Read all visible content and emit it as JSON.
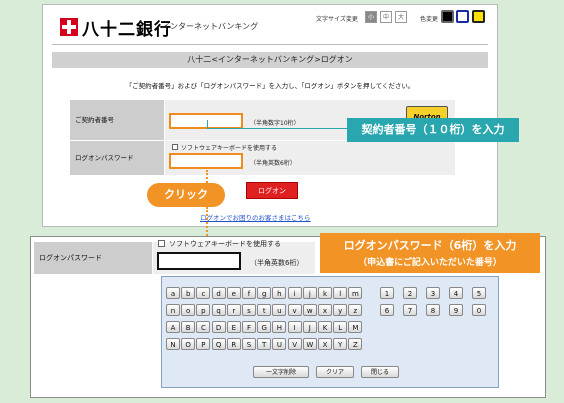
{
  "header": {
    "bank_name": "八十二銀行",
    "subtitle": "インターネットバンキング",
    "font_size_label": "文字サイズ変更",
    "font_sizes": [
      "小",
      "中",
      "大"
    ],
    "color_label": "色変更"
  },
  "page": {
    "title_bar": "八十二<インターネットバンキング>ログオン",
    "instruction": "「ご契約者番号」および「ログオンパスワード」を入力し、「ログオン」ボタンを押してください。",
    "contract_label": "ご契約者番号",
    "contract_note": "（半角数字10桁）",
    "software_kb_label": "ソフトウェアキーボードを使用する",
    "password_label": "ログオンパスワード",
    "password_note": "（半角英数6桁）",
    "norton": "Norton",
    "logon_button": "ログオン",
    "help_link": "ログオンでお困りのお客さまはこちら"
  },
  "annotations": {
    "contract_callout": "契約者番号（１０桁）を入力",
    "click_label": "クリック",
    "password_callout_1": "ログオンパスワード（6桁）を入力",
    "password_callout_2": "（申込書にご記入いただいた番号）"
  },
  "zoom": {
    "software_kb_label": "ソフトウェアキーボードを使用する",
    "password_label": "ログオンパスワード",
    "password_note": "（半角英数6桁）"
  },
  "keyboard": {
    "rows": [
      [
        "a",
        "b",
        "c",
        "d",
        "e",
        "f",
        "g",
        "h",
        "i",
        "j",
        "k",
        "l",
        "m",
        "1",
        "2",
        "3",
        "4",
        "5"
      ],
      [
        "n",
        "o",
        "p",
        "q",
        "r",
        "s",
        "t",
        "u",
        "v",
        "w",
        "x",
        "y",
        "z",
        "6",
        "7",
        "8",
        "9",
        "0"
      ],
      [
        "A",
        "B",
        "C",
        "D",
        "E",
        "F",
        "G",
        "H",
        "I",
        "J",
        "K",
        "L",
        "M"
      ],
      [
        "N",
        "O",
        "P",
        "Q",
        "R",
        "S",
        "T",
        "U",
        "V",
        "W",
        "X",
        "Y",
        "Z"
      ]
    ],
    "delete_one": "一文字削除",
    "clear": "クリア",
    "close": "閉じる"
  },
  "colors": {
    "accent_orange": "#f29326",
    "callout_teal": "#2aa6ae",
    "brand_red": "#d4021d"
  }
}
